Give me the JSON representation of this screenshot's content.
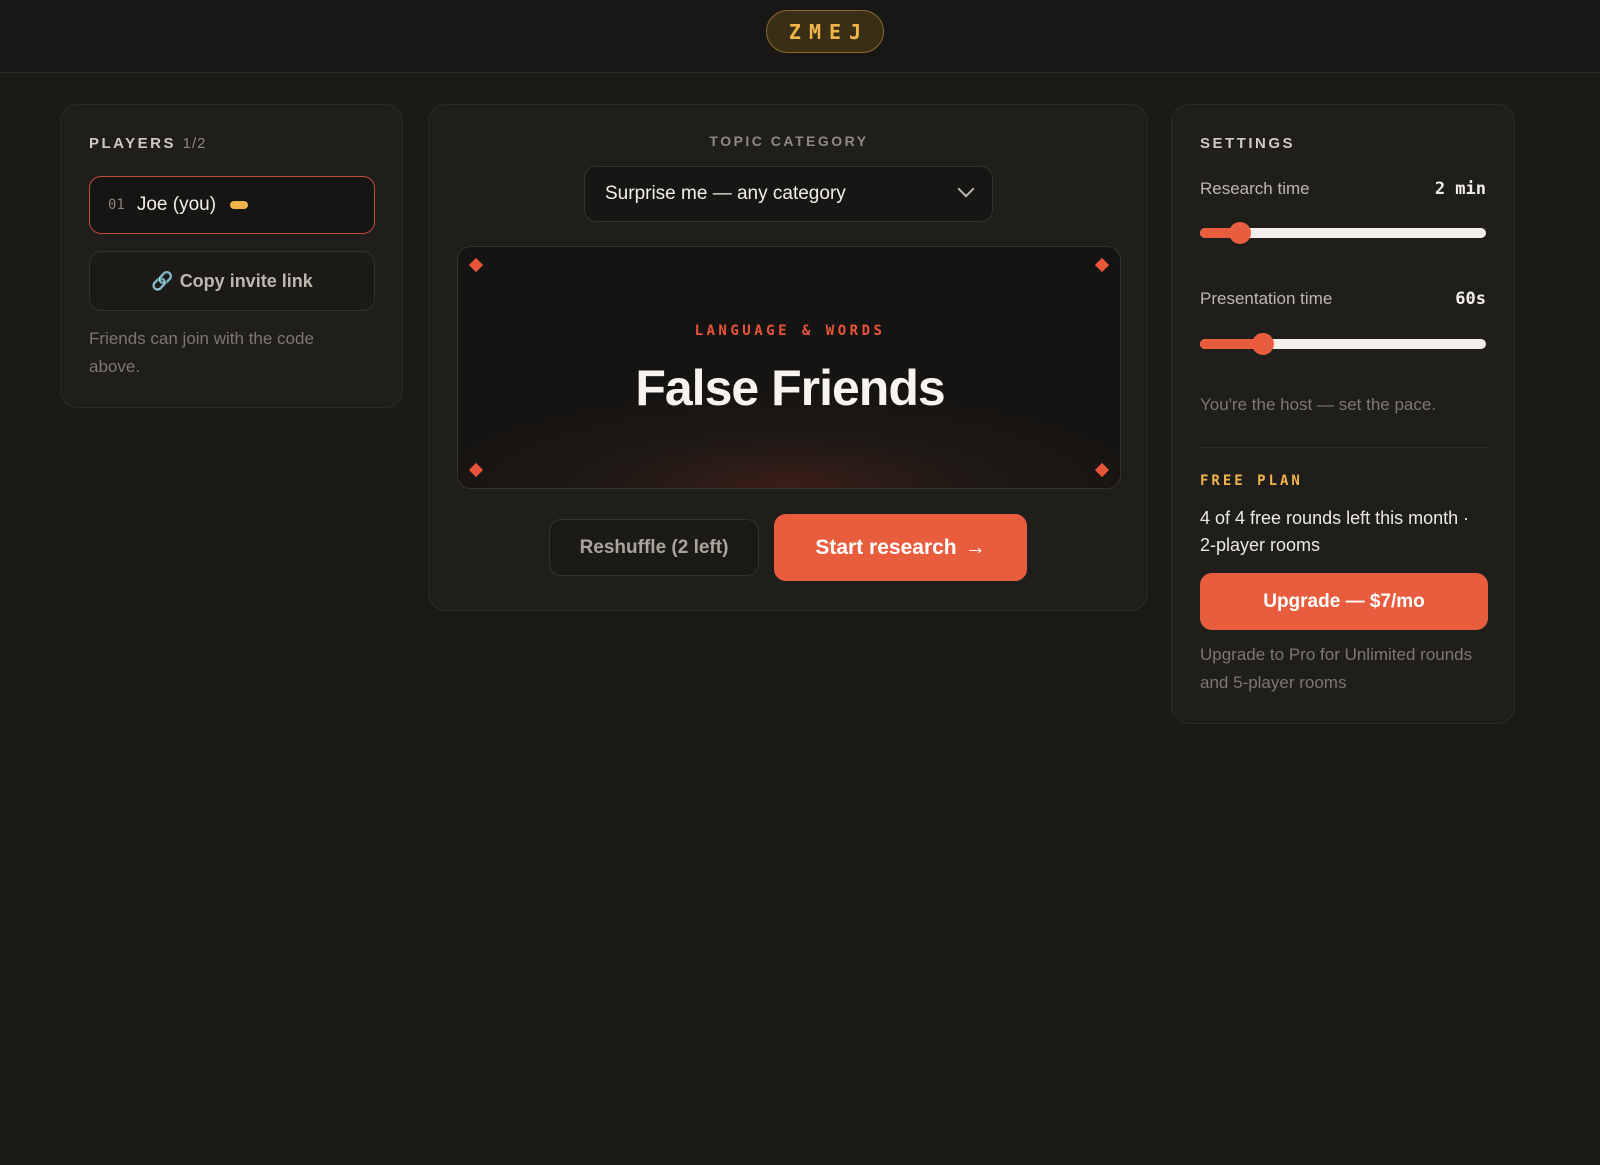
{
  "header": {
    "room_code": "ZMEJ"
  },
  "players": {
    "title": "PLAYERS",
    "count": "1/2",
    "list": [
      {
        "number": "01",
        "name": "Joe (you)",
        "is_host": true
      }
    ],
    "invite_button": {
      "label": "Copy invite link",
      "icon": "link-icon",
      "glyph": "🔗"
    },
    "hint": "Friends can join with the code above."
  },
  "topic": {
    "label": "TOPIC CATEGORY",
    "selected_category": "Surprise me — any category",
    "current": {
      "category": "LANGUAGE & WORDS",
      "title": "False Friends"
    },
    "reshuffle_label": "Reshuffle (2 left)",
    "start_label": "Start research",
    "start_arrow": "→"
  },
  "settings": {
    "title": "SETTINGS",
    "research_time": {
      "label": "Research time",
      "value": "2 min",
      "fraction": 0.14
    },
    "presentation_time": {
      "label": "Presentation time",
      "value": "60s",
      "fraction": 0.22
    },
    "host_note": "You're the host — set the pace.",
    "plan": {
      "label": "FREE PLAN",
      "text": "4 of 4 free rounds left this month · 2-player rooms",
      "upgrade_label": "Upgrade — $7/mo",
      "upgrade_note": "Upgrade to Pro for Unlimited rounds and 5-player rooms"
    }
  },
  "colors": {
    "accent": "#e95d3f",
    "gold": "#f0b54a",
    "background": "#1b1a17"
  }
}
